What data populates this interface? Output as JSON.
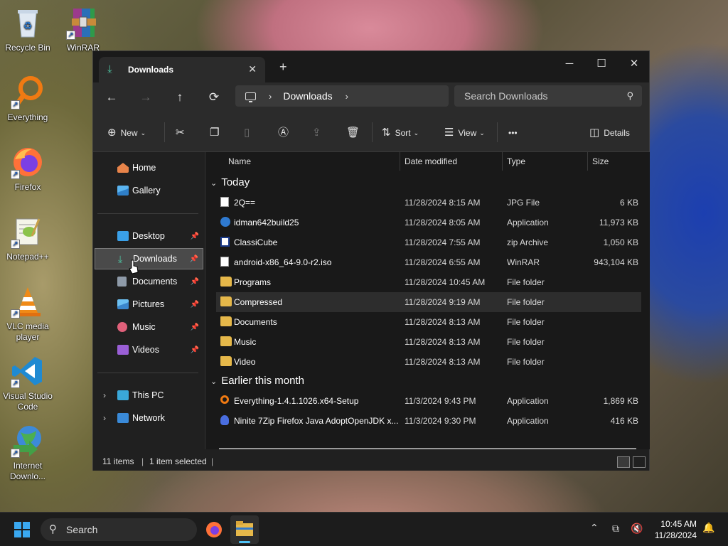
{
  "desktop": {
    "icons": [
      {
        "label": "Recycle Bin"
      },
      {
        "label": "WinRAR"
      },
      {
        "label": "Everything"
      },
      {
        "label": "Firefox"
      },
      {
        "label": "Notepad++"
      },
      {
        "label": "VLC media player"
      },
      {
        "label": "Visual Studio Code"
      },
      {
        "label": "Internet Downlo..."
      }
    ]
  },
  "window": {
    "tab_title": "Downloads",
    "new_tab": "+",
    "controls": {
      "minimize": "─",
      "maximize": "☐",
      "close": "✕"
    }
  },
  "nav": {
    "back": "←",
    "forward": "→",
    "up": "↑",
    "refresh": "⟳",
    "breadcrumb": "Downloads",
    "search_placeholder": "Search Downloads"
  },
  "toolbar": {
    "new_label": "New",
    "sort_label": "Sort",
    "view_label": "View",
    "more_label": "•••",
    "details_label": "Details"
  },
  "sidebar": {
    "home": "Home",
    "gallery": "Gallery",
    "desktop": "Desktop",
    "downloads": "Downloads",
    "documents": "Documents",
    "pictures": "Pictures",
    "music": "Music",
    "videos": "Videos",
    "this_pc": "This PC",
    "network": "Network"
  },
  "columns": {
    "name": "Name",
    "date": "Date modified",
    "type": "Type",
    "size": "Size"
  },
  "groups": {
    "today": "Today",
    "earlier": "Earlier this month"
  },
  "files": [
    {
      "name": "2Q==",
      "date": "11/28/2024 8:15 AM",
      "type": "JPG File",
      "size": "6 KB"
    },
    {
      "name": "idman642build25",
      "date": "11/28/2024 8:05 AM",
      "type": "Application",
      "size": "11,973 KB"
    },
    {
      "name": "ClassiCube",
      "date": "11/28/2024 7:55 AM",
      "type": "zip Archive",
      "size": "1,050 KB"
    },
    {
      "name": "android-x86_64-9.0-r2.iso",
      "date": "11/28/2024 6:55 AM",
      "type": "WinRAR",
      "size": "943,104 KB"
    },
    {
      "name": "Programs",
      "date": "11/28/2024 10:45 AM",
      "type": "File folder",
      "size": ""
    },
    {
      "name": "Compressed",
      "date": "11/28/2024 9:19 AM",
      "type": "File folder",
      "size": ""
    },
    {
      "name": "Documents",
      "date": "11/28/2024 8:13 AM",
      "type": "File folder",
      "size": ""
    },
    {
      "name": "Music",
      "date": "11/28/2024 8:13 AM",
      "type": "File folder",
      "size": ""
    },
    {
      "name": "Video",
      "date": "11/28/2024 8:13 AM",
      "type": "File folder",
      "size": ""
    },
    {
      "name": "Everything-1.4.1.1026.x64-Setup",
      "date": "11/3/2024 9:43 PM",
      "type": "Application",
      "size": "1,869 KB"
    },
    {
      "name": "Ninite 7Zip Firefox Java AdoptOpenJDK x...",
      "date": "11/3/2024 9:30 PM",
      "type": "Application",
      "size": "416 KB"
    }
  ],
  "status": {
    "items": "11 items",
    "selected": "1 item selected",
    "sep": "|"
  },
  "taskbar": {
    "search_label": "Search",
    "time": "10:45 AM",
    "date": "11/28/2024"
  },
  "colors": {
    "accent": "#4fc3a1",
    "folder": "#e6b84a",
    "selected_row": "#2d2d2d"
  }
}
